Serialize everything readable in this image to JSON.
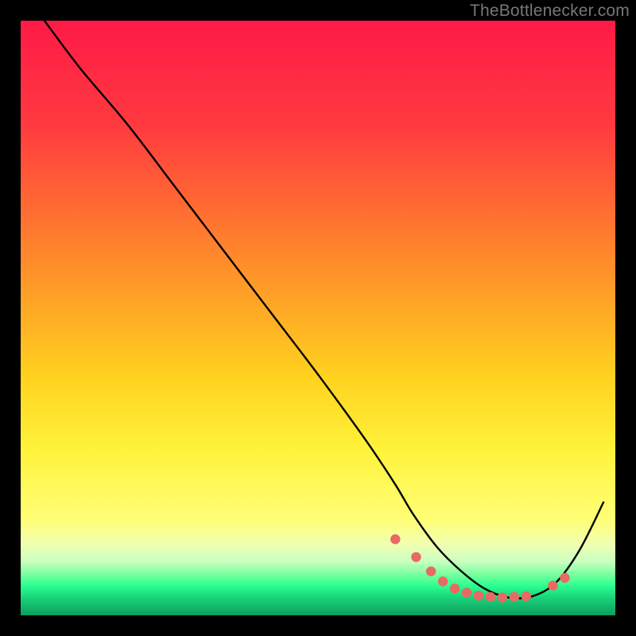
{
  "watermark": "TheBottlenecker.com",
  "chart_data": {
    "type": "line",
    "title": "",
    "xlabel": "",
    "ylabel": "",
    "xlim": [
      0,
      100
    ],
    "ylim": [
      0,
      100
    ],
    "gradient_stops": [
      {
        "offset": 0,
        "color": "#ff1a47"
      },
      {
        "offset": 18,
        "color": "#ff3b3f"
      },
      {
        "offset": 40,
        "color": "#ff8a2b"
      },
      {
        "offset": 60,
        "color": "#ffd21f"
      },
      {
        "offset": 72,
        "color": "#fff23a"
      },
      {
        "offset": 84,
        "color": "#ffff77"
      },
      {
        "offset": 88,
        "color": "#f1ffb0"
      },
      {
        "offset": 91,
        "color": "#c8ffc0"
      },
      {
        "offset": 93,
        "color": "#7effa0"
      },
      {
        "offset": 95,
        "color": "#2dff90"
      },
      {
        "offset": 97,
        "color": "#19d47a"
      },
      {
        "offset": 100,
        "color": "#0a9e5c"
      }
    ],
    "series": [
      {
        "name": "curve",
        "x": [
          4,
          10,
          18,
          26,
          34,
          42,
          50,
          58,
          63,
          66,
          70,
          74,
          78,
          82,
          86,
          90,
          94,
          98
        ],
        "y": [
          100,
          92,
          82.5,
          72,
          61.5,
          51,
          40.5,
          29.5,
          22,
          17,
          11.5,
          7.5,
          4.5,
          3,
          3.2,
          5.5,
          11,
          19
        ]
      }
    ],
    "markers": {
      "name": "dots",
      "x": [
        63,
        66.5,
        69,
        71,
        73,
        75,
        77,
        79,
        81,
        83,
        85,
        89.5,
        91.5
      ],
      "y": [
        12.8,
        9.8,
        7.4,
        5.7,
        4.5,
        3.8,
        3.3,
        3.1,
        3.0,
        3.1,
        3.2,
        5.0,
        6.3
      ],
      "color": "#e86a63",
      "radius": 6.2
    }
  }
}
